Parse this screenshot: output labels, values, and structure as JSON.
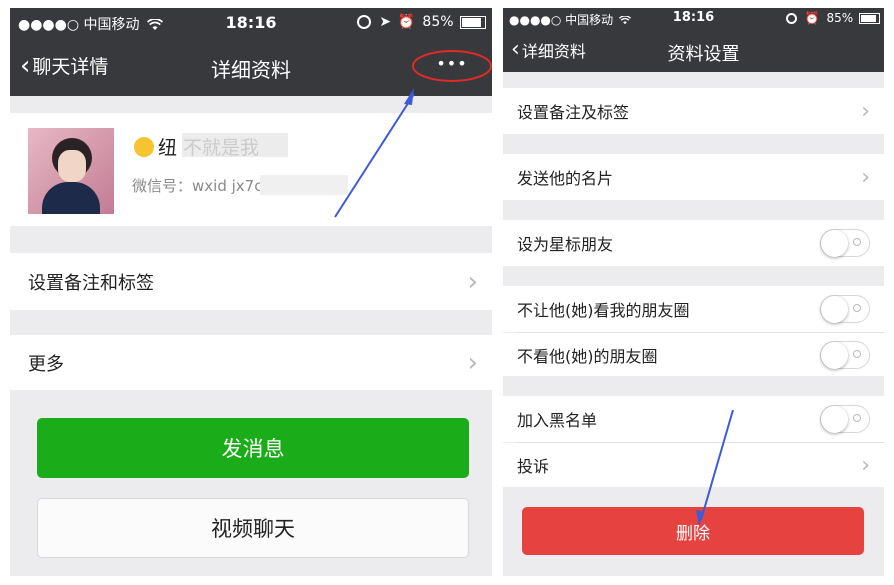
{
  "left": {
    "status": {
      "carrier": "●●●●○ 中国移动",
      "time": "18:16",
      "battery": "85%"
    },
    "nav": {
      "back_label": "聊天详情",
      "title": "详细资料",
      "more_glyph": "•••"
    },
    "profile": {
      "name": "纽  不就是我",
      "wechat_id": "微信号：wxid       jx7cs22"
    },
    "rows": {
      "remark_tags": "设置备注和标签",
      "more": "更多"
    },
    "buttons": {
      "message": "发消息",
      "video_call": "视频聊天"
    }
  },
  "right": {
    "status": {
      "carrier": "●●●●○ 中国移动",
      "time": "18:16",
      "battery": "85%"
    },
    "nav": {
      "back_label": "详细资料",
      "title": "资料设置"
    },
    "rows": {
      "remark_tags": "设置备注及标签",
      "send_card": "发送他的名片",
      "star_friend": "设为星标朋友",
      "hide_my_moments": "不让他(她)看我的朋友圈",
      "hide_their_moments": "不看他(她)的朋友圈",
      "blacklist": "加入黑名单",
      "report": "投诉"
    },
    "buttons": {
      "delete": "删除"
    }
  },
  "colors": {
    "nav_bg": "#37393d",
    "green": "#1aad19",
    "red": "#e64340",
    "annotation": "#e02a25",
    "arrow": "#3d5ad8"
  }
}
